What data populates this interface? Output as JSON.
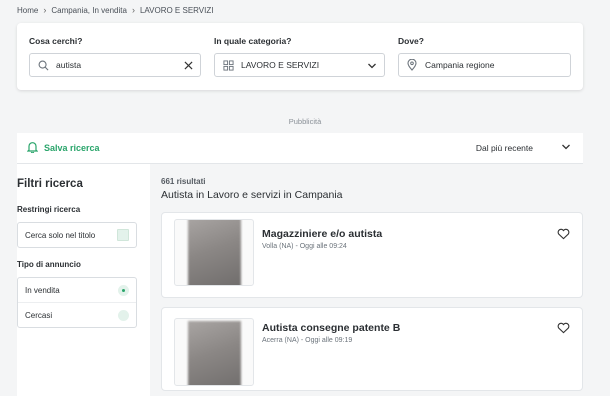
{
  "breadcrumb": [
    "Home",
    "Campania, In vendita",
    "LAVORO E SERVIZI"
  ],
  "search": {
    "what_label": "Cosa cerchi?",
    "what_value": "autista",
    "category_label": "In quale categoria?",
    "category_value": "LAVORO E SERVIZI",
    "where_label": "Dove?",
    "where_value": "Campania regione"
  },
  "ad_label": "Pubblicità",
  "toolbar": {
    "save_label": "Salva ricerca",
    "sort_value": "Dal più recente"
  },
  "filters": {
    "title": "Filtri ricerca",
    "restrict_label": "Restringi ricerca",
    "title_only_label": "Cerca solo nel titolo",
    "type_label": "Tipo di annuncio",
    "type_options": [
      "In vendita",
      "Cercasi"
    ],
    "type_selected": "In vendita"
  },
  "results": {
    "count": "661 risultati",
    "heading": "Autista in Lavoro e servizi in Campania",
    "items": [
      {
        "title": "Magazziniere e/o autista",
        "meta": "Volla (NA) - Oggi alle 09:24"
      },
      {
        "title": "Autista consegne patente B",
        "meta": "Acerra (NA) - Oggi alle 09:19"
      }
    ]
  },
  "colors": {
    "accent": "#2aa56b",
    "background": "#f4f5f6",
    "text": "#2b2f33"
  }
}
